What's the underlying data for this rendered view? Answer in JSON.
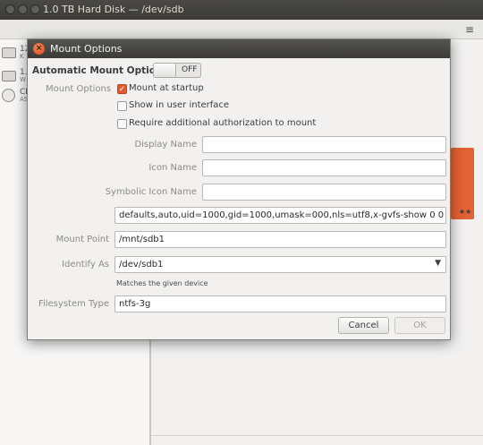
{
  "window": {
    "title": "1.0 TB Hard Disk — /dev/sdb",
    "menu_icon": "hamburger-menu-icon"
  },
  "sidebar": {
    "devices": [
      {
        "label": "12",
        "sub": "K",
        "icon": "hard-disk-icon"
      },
      {
        "label": "1.",
        "sub": "W",
        "icon": "hard-disk-icon"
      },
      {
        "label": "CD",
        "sub": "AS",
        "icon": "optical-disc-icon"
      }
    ]
  },
  "background": {
    "stars": "★★",
    "accent": "#e36234"
  },
  "dialog": {
    "title": "Mount Options",
    "close_icon": "close-icon",
    "automatic_label": "Automatic Mount Options",
    "automatic_switch": "OFF",
    "mount_options_label": "Mount Options",
    "options": [
      {
        "label": "Mount at startup",
        "checked": true
      },
      {
        "label": "Show in user interface",
        "checked": false
      },
      {
        "label": "Require additional authorization to mount",
        "checked": false
      }
    ],
    "display_name_label": "Display Name",
    "display_name_value": "",
    "icon_name_label": "Icon Name",
    "icon_name_value": "",
    "symbolic_icon_name_label": "Symbolic Icon Name",
    "symbolic_icon_name_value": "",
    "options_string": "defaults,auto,uid=1000,gid=1000,umask=000,nls=utf8,x-gvfs-show 0 0",
    "mount_point_label": "Mount Point",
    "mount_point_value": "/mnt/sdb1",
    "identify_as_label": "Identify As",
    "identify_as_value": "/dev/sdb1",
    "identify_hint": "Matches the given device",
    "filesystem_type_label": "Filesystem Type",
    "filesystem_type_value": "ntfs-3g",
    "cancel_label": "Cancel",
    "ok_label": "OK"
  }
}
